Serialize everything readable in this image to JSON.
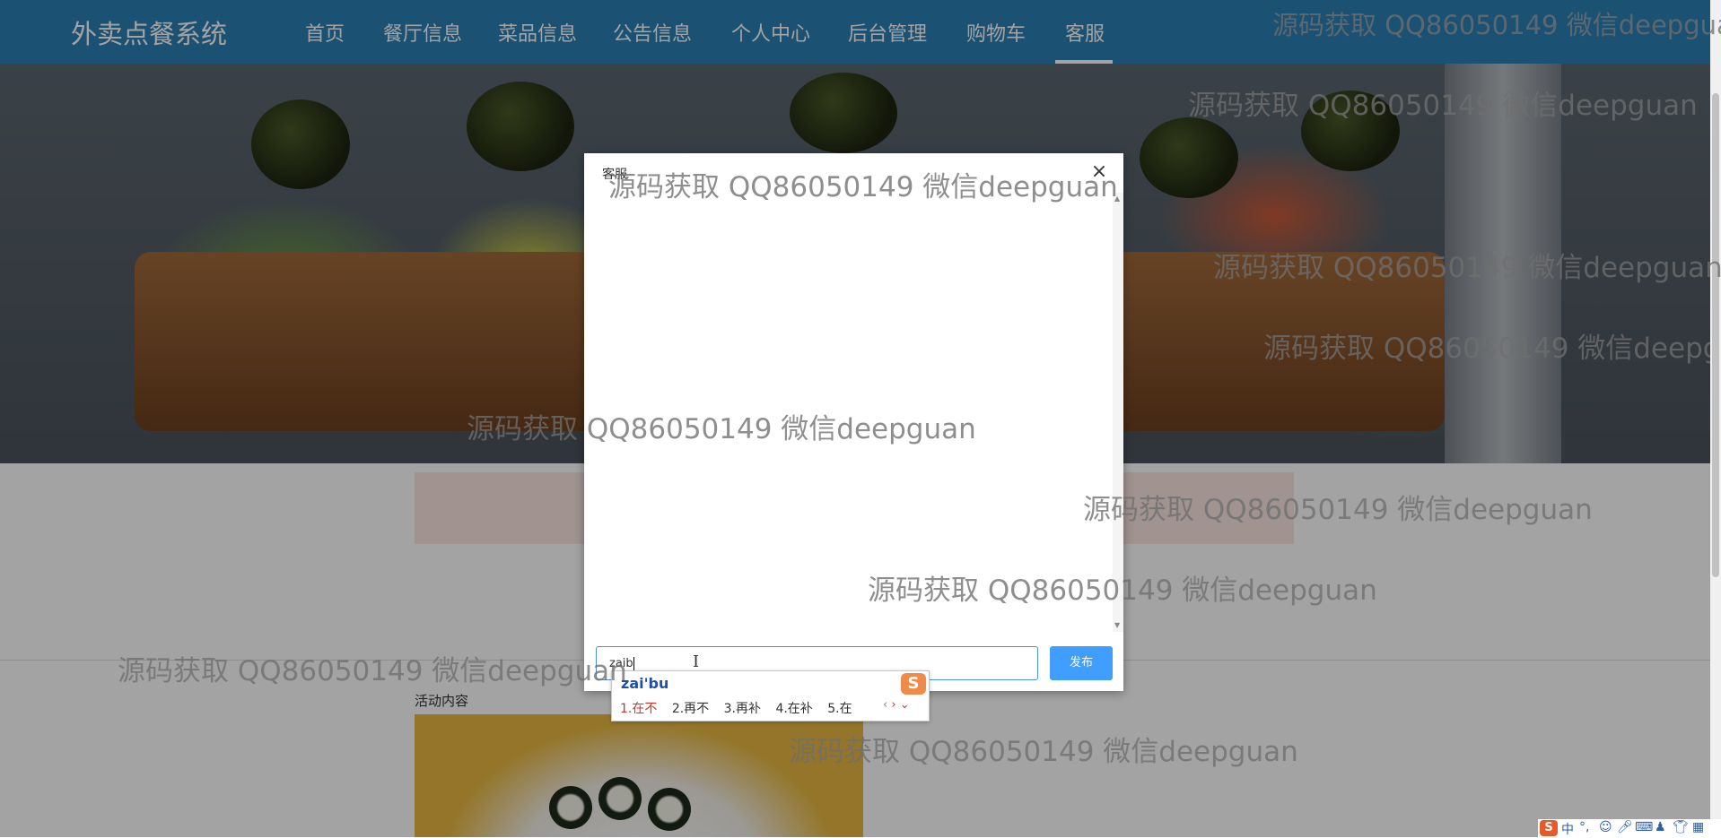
{
  "nav": {
    "brand": "外卖点餐系统",
    "items": [
      "首页",
      "餐厅信息",
      "菜品信息",
      "公告信息",
      "个人中心",
      "后台管理",
      "购物车",
      "客服"
    ],
    "active": "客服"
  },
  "content": {
    "activity_label": "活动内容"
  },
  "modal": {
    "title": "客服",
    "close_glyph": "×",
    "input_value": "zaib",
    "send_label": "发布"
  },
  "ime": {
    "pinyin": "zai'bu",
    "logo": "S",
    "candidates": [
      "1.在不",
      "2.再不",
      "3.再补",
      "4.在补",
      "5.在"
    ],
    "nav_prev": "‹",
    "nav_next": "›",
    "nav_more": "⌄"
  },
  "watermark": {
    "text": "源码获取 QQ86050149 微信deepguan"
  },
  "tray": {
    "logo": "S",
    "lang": "中"
  },
  "colors": {
    "nav_bg": "#2b7fb4",
    "send_button": "#409eff",
    "input_border": "#4a90d9",
    "ime_first_candidate": "#d0342c"
  }
}
